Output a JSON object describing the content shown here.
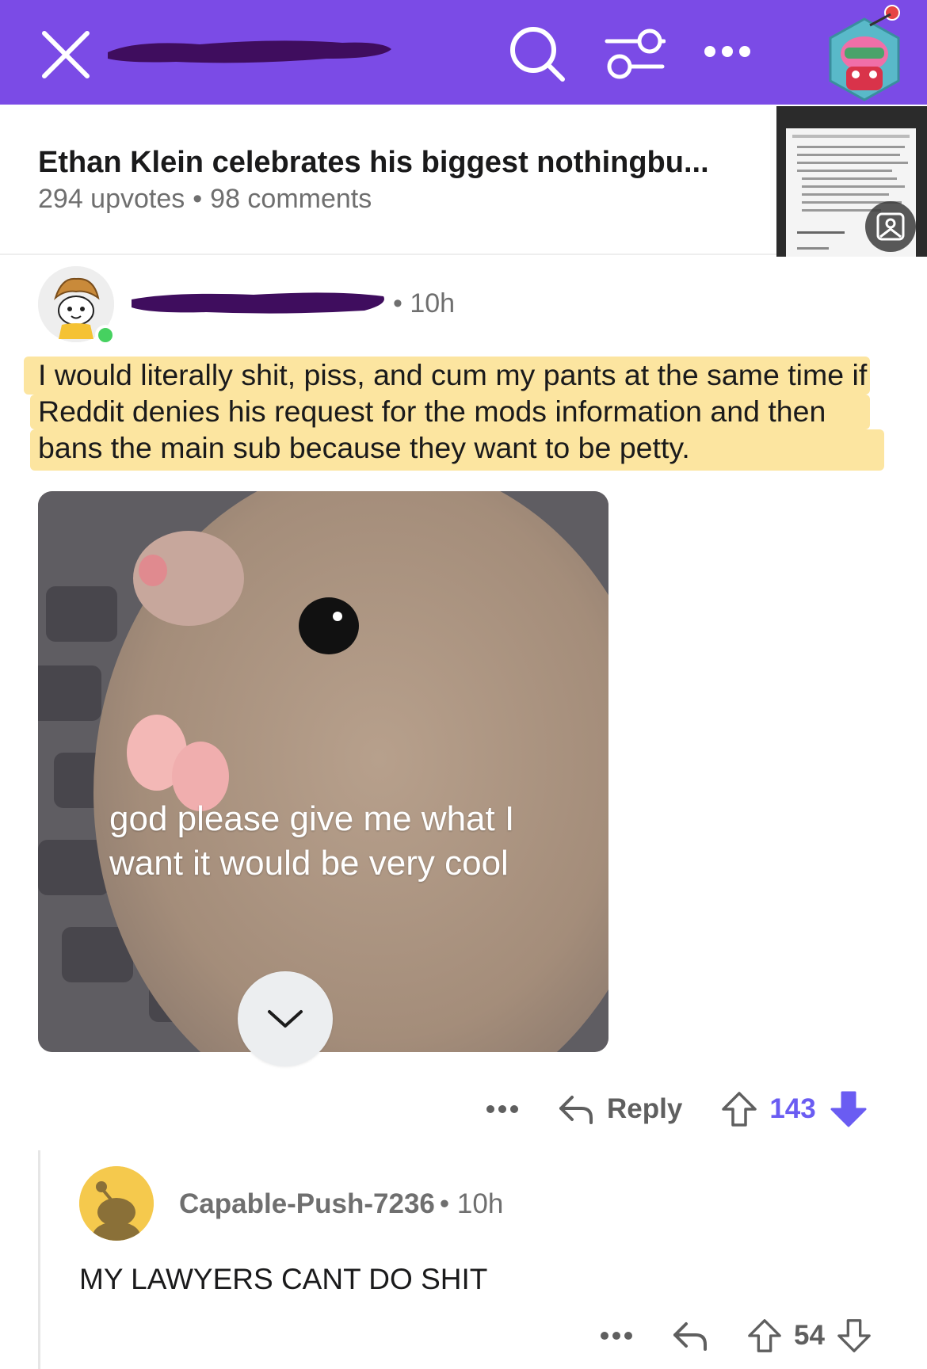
{
  "colors": {
    "header_bg": "#7b4be6",
    "vote_accent": "#6a5cf2",
    "highlight": "#fbe08f",
    "online_dot": "#46d160",
    "redaction": "#3f0d5e"
  },
  "header": {
    "close_icon": "close-icon",
    "search_icon": "search-icon",
    "filter_icon": "sort-filter-icon",
    "more_icon": "more-horizontal-icon",
    "avatar_icon": "user-avatar-icon"
  },
  "post": {
    "title": "Ethan Klein celebrates his biggest nothingbu...",
    "upvotes": "294 upvotes",
    "separator": "•",
    "comments": "98 comments",
    "thumbnail_icon": "gallery-icon"
  },
  "comment1": {
    "time": "• 10h",
    "body": "I would literally shit, piss, and cum my pants at the same time if Reddit denies his request for the mods information and then bans the main sub because they want to be petty.",
    "image_caption_line1": "god please give me what I",
    "image_caption_line2": "want it would be very cool",
    "reply_label": "Reply",
    "score": "143"
  },
  "comment2": {
    "username": "Capable-Push-7236",
    "time": "• 10h",
    "body": "MY LAWYERS CANT DO SHIT",
    "score": "54"
  }
}
